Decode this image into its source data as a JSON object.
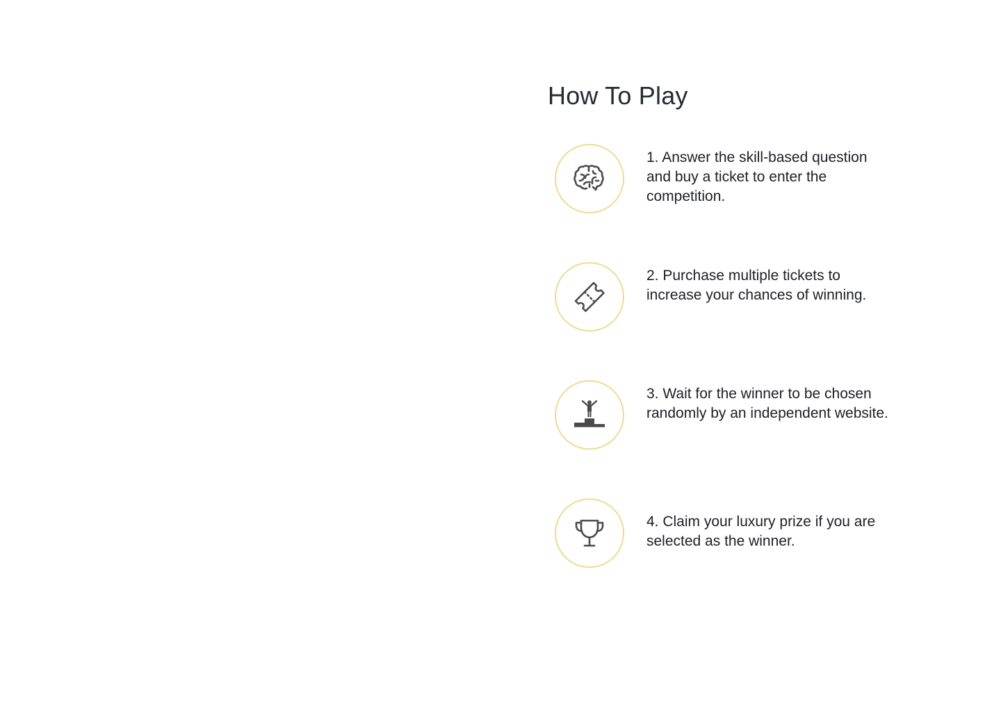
{
  "how_to_play": {
    "title": "How To Play",
    "steps": [
      {
        "icon": "brain-icon",
        "text": "1. Answer the skill-based question and buy a ticket to enter the competition."
      },
      {
        "icon": "ticket-icon",
        "text": "2. Purchase multiple tickets to increase your chances of winning."
      },
      {
        "icon": "podium-winner-icon",
        "text": "3. Wait for the winner to be chosen randomly by an independent website."
      },
      {
        "icon": "trophy-icon",
        "text": "4. Claim your luxury prize if you are selected as the winner."
      }
    ]
  },
  "colors": {
    "circle_border": "#eedb92",
    "icon": "#4a4a4a",
    "title": "#262a33",
    "text": "#1d1f24"
  }
}
